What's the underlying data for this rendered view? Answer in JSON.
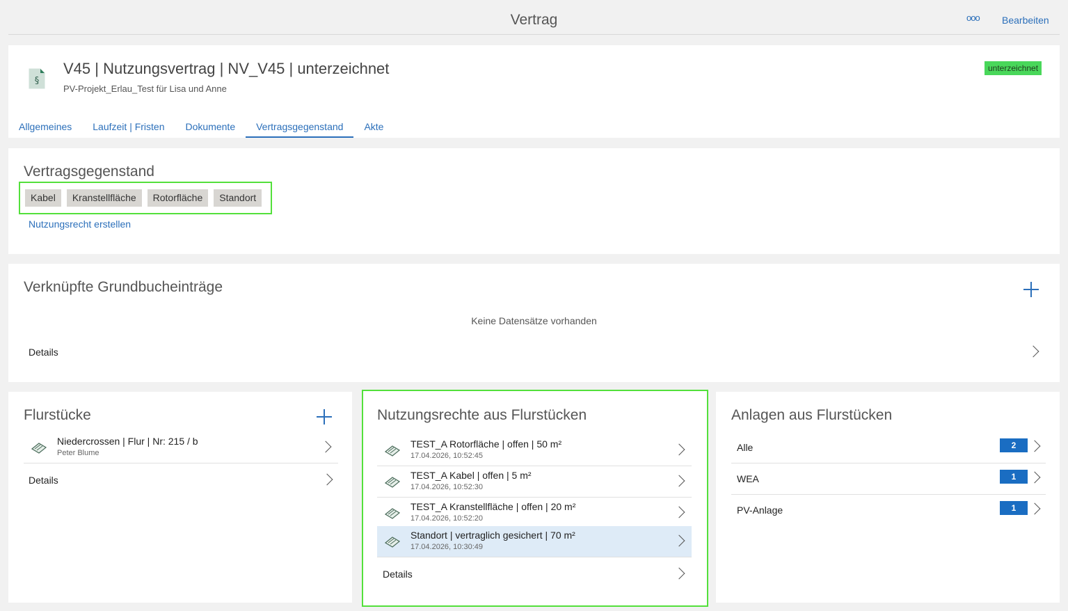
{
  "topbar": {
    "title": "Vertrag",
    "more_label": "ooo",
    "edit_label": "Bearbeiten"
  },
  "header": {
    "title": "V45 | Nutzungsvertrag | NV_V45 | unterzeichnet",
    "subtitle": "PV-Projekt_Erlau_Test für Lisa und Anne",
    "status": "unterzeichnet",
    "status_color": "#49d75a",
    "icon": "contract-document-icon",
    "tabs": [
      {
        "label": "Allgemeines",
        "active": false
      },
      {
        "label": "Laufzeit | Fristen",
        "active": false
      },
      {
        "label": "Dokumente",
        "active": false
      },
      {
        "label": "Vertragsgegenstand",
        "active": true
      },
      {
        "label": "Akte",
        "active": false
      }
    ]
  },
  "vertragsgegenstand": {
    "title": "Vertragsgegenstand",
    "chips": [
      "Kabel",
      "Kranstellfläche",
      "Rotorfläche",
      "Standort"
    ],
    "create_link": "Nutzungsrecht erstellen"
  },
  "grundbuch": {
    "title": "Verknüpfte Grundbucheinträge",
    "empty_text": "Keine Datensätze vorhanden",
    "details_label": "Details"
  },
  "flurstuecke": {
    "title": "Flurstücke",
    "items": [
      {
        "title": "Niedercrossen | Flur | Nr: 215 / b",
        "subtitle": "Peter Blume"
      }
    ],
    "details_label": "Details"
  },
  "nutzungsrechte": {
    "title": "Nutzungsrechte aus Flurstücken",
    "items": [
      {
        "title": "TEST_A Rotorfläche | offen | 50 m²",
        "subtitle": "17.04.2026, 10:52:45",
        "selected": false
      },
      {
        "title": "TEST_A Kabel | offen | 5 m²",
        "subtitle": "17.04.2026, 10:52:30",
        "selected": false
      },
      {
        "title": "TEST_A Kranstellfläche | offen | 20 m²",
        "subtitle": "17.04.2026, 10:52:20",
        "selected": false
      },
      {
        "title": "Standort | vertraglich gesichert | 70 m²",
        "subtitle": "17.04.2026, 10:30:49",
        "selected": true
      }
    ],
    "details_label": "Details"
  },
  "anlagen": {
    "title": "Anlagen aus Flurstücken",
    "items": [
      {
        "label": "Alle",
        "count": "2"
      },
      {
        "label": "WEA",
        "count": "1"
      },
      {
        "label": "PV-Anlage",
        "count": "1"
      }
    ]
  }
}
